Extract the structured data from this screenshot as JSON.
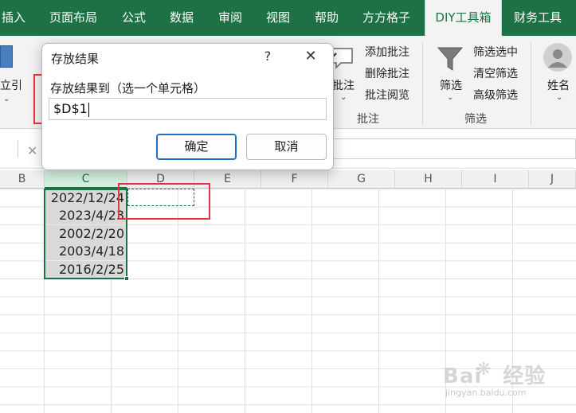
{
  "ribbon_tabs": [
    {
      "label": "插入",
      "active": false
    },
    {
      "label": "页面布局",
      "active": false
    },
    {
      "label": "公式",
      "active": false
    },
    {
      "label": "数据",
      "active": false
    },
    {
      "label": "审阅",
      "active": false
    },
    {
      "label": "视图",
      "active": false
    },
    {
      "label": "帮助",
      "active": false
    },
    {
      "label": "方方格子",
      "active": false
    },
    {
      "label": "DIY工具箱",
      "active": true
    },
    {
      "label": "财务工具",
      "active": false
    }
  ],
  "ribbon": {
    "left_cut_label": "立引",
    "comment_button": "批注",
    "comment_items": [
      "添加批注",
      "删除批注",
      "批注阅览"
    ],
    "comment_group": "批注",
    "filter_button": "筛选",
    "filter_items": [
      "筛选选中",
      "清空筛选",
      "高级筛选"
    ],
    "filter_group": "筛选",
    "name_button": "姓名"
  },
  "formula_bar": {
    "cancel_glyph": "✕"
  },
  "columns": [
    "B",
    "C",
    "D",
    "E",
    "F",
    "G",
    "H",
    "I",
    "J"
  ],
  "cells": [
    "2022/12/24",
    "2023/4/23",
    "2002/2/20",
    "2003/4/18",
    "2016/2/25"
  ],
  "dialog": {
    "title": "存放结果",
    "help": "?",
    "close": "✕",
    "label": "存放结果到（选一个单元格）",
    "input_value": "$D$1",
    "ok_label": "确定",
    "cancel_label": "取消"
  },
  "watermark": {
    "brand": "Bai",
    "brand_tail": "经验",
    "url": "jingyan.baidu.com"
  }
}
